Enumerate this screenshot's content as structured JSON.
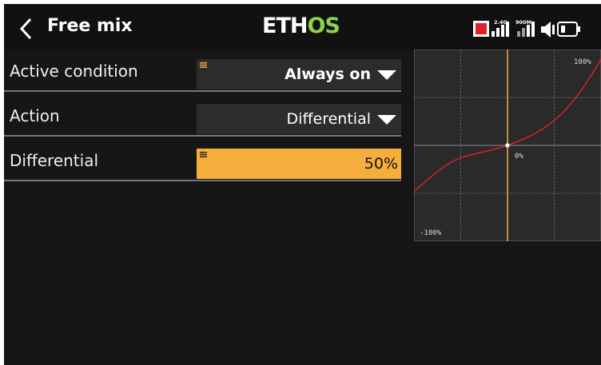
{
  "header": {
    "title": "Free mix",
    "logo_left": "ETH",
    "logo_right": "OS",
    "rf_label": "2.4G",
    "rf900_label": "900M"
  },
  "fields": {
    "active_condition": {
      "label": "Active condition",
      "value": "Always on"
    },
    "action": {
      "label": "Action",
      "value": "Differential"
    },
    "differential": {
      "label": "Differential",
      "value": "50%"
    }
  },
  "graph": {
    "label_top": "100%",
    "label_center": "0%",
    "label_bottom": "-100%"
  },
  "colors": {
    "accent": "#f5ae3c",
    "curve": "#c8242a",
    "brand_green": "#8fd14b",
    "record": "#e0202a"
  }
}
